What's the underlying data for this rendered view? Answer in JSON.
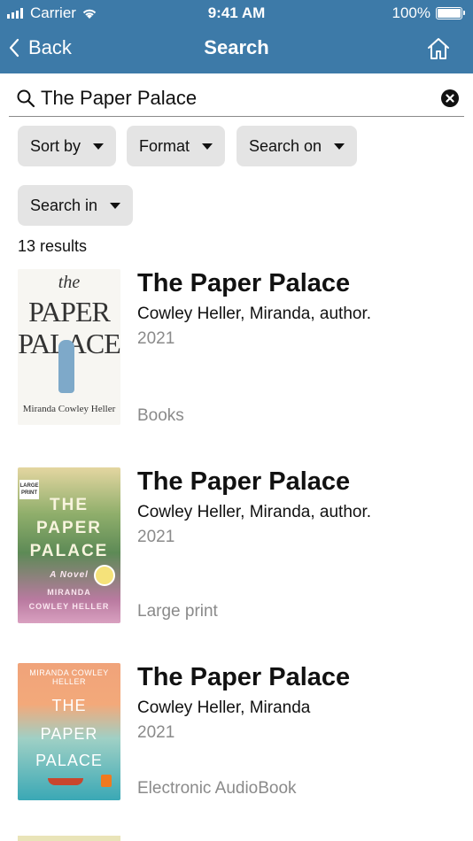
{
  "status_bar": {
    "carrier": "Carrier",
    "time": "9:41 AM",
    "battery": "100%"
  },
  "nav": {
    "back_label": "Back",
    "title": "Search"
  },
  "search": {
    "value": "The Paper Palace"
  },
  "filters": [
    "Sort by",
    "Format",
    "Search on",
    "Search in"
  ],
  "results_count": "13 results",
  "results": [
    {
      "title": "The Paper Palace",
      "author": "Cowley Heller, Miranda, author.",
      "year": "2021",
      "format": "Books",
      "cover": {
        "line1": "the",
        "line2": "PAPER",
        "line3": "PALACE",
        "author": "Miranda Cowley Heller"
      }
    },
    {
      "title": "The Paper Palace",
      "author": "Cowley Heller, Miranda, author.",
      "year": "2021",
      "format": "Large print",
      "cover": {
        "badge": "LARGE PRINT",
        "line1": "THE",
        "line2": "PAPER",
        "line3": "PALACE",
        "sub": "A Novel",
        "author1": "MIRANDA",
        "author2": "COWLEY HELLER"
      }
    },
    {
      "title": "The Paper Palace",
      "author": "Cowley Heller, Miranda",
      "year": "2021",
      "format": "Electronic AudioBook",
      "cover": {
        "author": "MIRANDA COWLEY HELLER",
        "line1": "THE",
        "line2": "PAPER",
        "line3": "PALACE"
      }
    }
  ],
  "colors": {
    "header": "#3d7aa8",
    "chip": "#e4e4e4",
    "muted_text": "#8a8a8a"
  }
}
